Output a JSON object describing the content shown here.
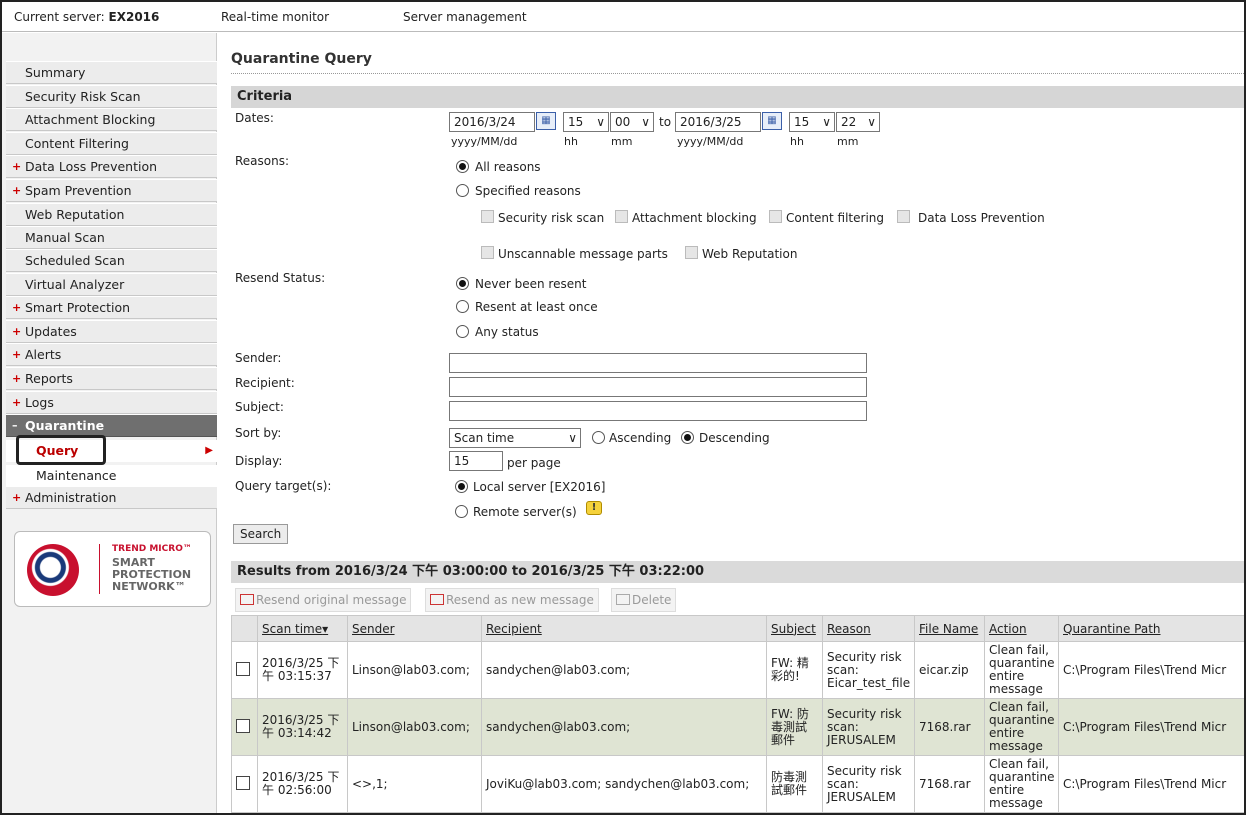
{
  "topbar": {
    "server_prefix": "Current server: ",
    "server_name": "EX2016",
    "nav": [
      "Real-time monitor",
      "Server management"
    ]
  },
  "sidebar": {
    "items": [
      {
        "label": "Summary",
        "plus": false
      },
      {
        "label": "Security Risk Scan",
        "plus": false
      },
      {
        "label": "Attachment Blocking",
        "plus": false
      },
      {
        "label": "Content Filtering",
        "plus": false
      },
      {
        "label": "Data Loss Prevention",
        "plus": true
      },
      {
        "label": "Spam Prevention",
        "plus": true
      },
      {
        "label": "Web Reputation",
        "plus": false
      },
      {
        "label": "Manual Scan",
        "plus": false
      },
      {
        "label": "Scheduled Scan",
        "plus": false
      },
      {
        "label": "Virtual Analyzer",
        "plus": false
      },
      {
        "label": "Smart Protection",
        "plus": true
      },
      {
        "label": "Updates",
        "plus": true
      },
      {
        "label": "Alerts",
        "plus": true
      },
      {
        "label": "Reports",
        "plus": true
      },
      {
        "label": "Logs",
        "plus": true
      },
      {
        "label": "Quarantine",
        "plus": true
      }
    ],
    "sub_items": [
      "Query",
      "Maintenance"
    ],
    "after": {
      "label": "Administration",
      "plus": true
    },
    "plus_glyph": "+",
    "minus_glyph": "–",
    "logo": {
      "brand": "TREND MICRO™",
      "line1": "SMART",
      "line2": "PROTECTION",
      "line3": "NETWORK™"
    }
  },
  "page": {
    "title": "Quarantine Query",
    "criteria": "Criteria",
    "dates_label": "Dates:",
    "date_from": "2016/3/24",
    "hh_from": "15",
    "mm_from": "00",
    "to": "to",
    "date_to": "2016/3/25",
    "hh_to": "15",
    "mm_to": "22",
    "fmt_date": "yyyy/MM/dd",
    "fmt_hh": "hh",
    "fmt_mm": "mm",
    "reasons_label": "Reasons:",
    "all_reasons": "All reasons",
    "specified_reasons": "Specified reasons",
    "reason_opts": [
      "Security risk scan",
      "Attachment blocking",
      "Content filtering",
      "Data Loss Prevention",
      "Unscannable message parts",
      "Web Reputation"
    ],
    "resend_label": "Resend Status:",
    "never_resent": "Never been resent",
    "resent_once": "Resent at least once",
    "any_status": "Any status",
    "sender_label": "Sender:",
    "recipient_label": "Recipient:",
    "subject_label": "Subject:",
    "sort_label": "Sort by:",
    "sort_value": "Scan time",
    "ascending": "Ascending",
    "descending": "Descending",
    "display_label": "Display:",
    "display_value": "15",
    "per_page": "per page",
    "target_label": "Query target(s):",
    "local_server": "Local server  [EX2016]",
    "remote_servers": "Remote server(s)",
    "search": "Search",
    "results_title": "Results from 2016/3/24 下午 03:00:00 to 2016/3/25 下午 03:22:00",
    "toolbar": [
      "Resend original message",
      "Resend as new message",
      "Delete"
    ]
  },
  "table": {
    "headers": [
      "Scan time",
      "Sender",
      "Recipient",
      "Subject",
      "Reason",
      "File Name",
      "Action",
      "Quarantine Path"
    ],
    "rows": [
      {
        "time": "2016/3/25 下午 03:15:37",
        "sender": "Linson@lab03.com;",
        "recipient": "sandychen@lab03.com;",
        "subject": "FW: 精彩的!",
        "reason": "Security risk scan: Eicar_test_file",
        "file": "eicar.zip",
        "action": "Clean fail, quarantine entire message",
        "path": "C:\\Program Files\\Trend Micr"
      },
      {
        "time": "2016/3/25 下午 03:14:42",
        "sender": "Linson@lab03.com;",
        "recipient": "sandychen@lab03.com;",
        "subject": "FW: 防毒測試郵件",
        "reason": "Security risk scan: JERUSALEM",
        "file": "7168.rar",
        "action": "Clean fail, quarantine entire message",
        "path": "C:\\Program Files\\Trend Micr"
      },
      {
        "time": "2016/3/25 下午 02:56:00",
        "sender": "<>,1;",
        "recipient": "JoviKu@lab03.com; sandychen@lab03.com;",
        "subject": "防毒測試郵件",
        "reason": "Security risk scan: JERUSALEM",
        "file": "7168.rar",
        "action": "Clean fail, quarantine entire message",
        "path": "C:\\Program Files\\Trend Micr"
      }
    ],
    "sort_arrow": "▾"
  },
  "icons": {
    "dropdown": "∨",
    "calendar": "▦",
    "hint": "!",
    "submenu_arrow": "▶"
  }
}
